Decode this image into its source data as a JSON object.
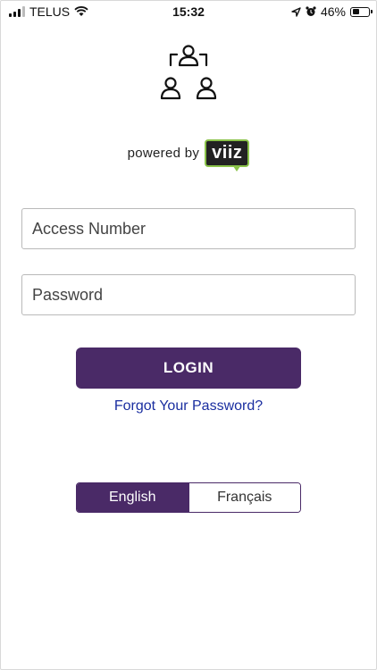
{
  "status_bar": {
    "carrier": "TELUS",
    "time": "15:32",
    "battery_percent": "46%",
    "battery_level": 0.46,
    "icons": [
      "signal-icon",
      "wifi-icon",
      "location-icon",
      "alarm-icon",
      "battery-icon"
    ]
  },
  "branding": {
    "icon": "people-network-icon",
    "powered_by": "powered by",
    "brand": "viiz",
    "brand_border_color": "#8bc34a"
  },
  "login_form": {
    "access_placeholder": "Access Number",
    "password_placeholder": "Password",
    "login_label": "LOGIN",
    "forgot_label": "Forgot Your Password?"
  },
  "language": {
    "options": [
      "English",
      "Français"
    ],
    "selected": "English"
  },
  "colors": {
    "accent": "#4a2a67",
    "link": "#1a2ea0"
  }
}
